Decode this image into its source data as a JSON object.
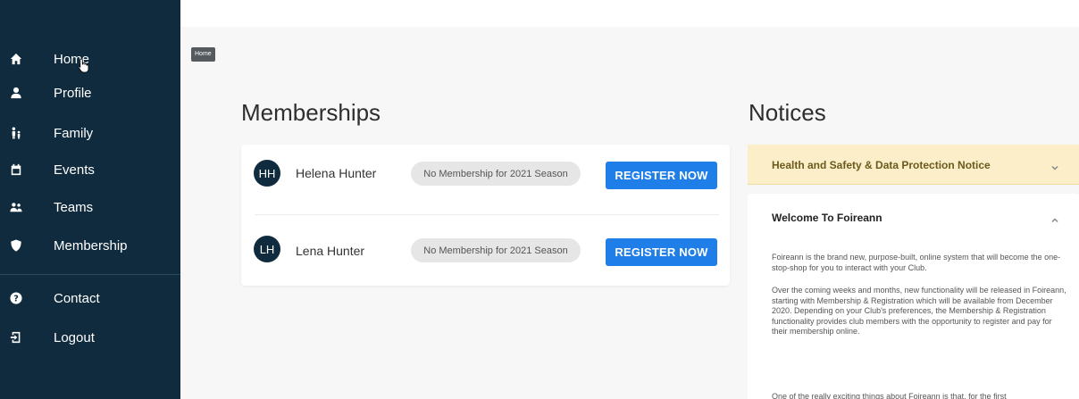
{
  "sidebar": {
    "items": [
      {
        "label": "Home",
        "icon": "home-icon"
      },
      {
        "label": "Profile",
        "icon": "user-icon"
      },
      {
        "label": "Family",
        "icon": "family-icon"
      },
      {
        "label": "Events",
        "icon": "calendar-icon"
      },
      {
        "label": "Teams",
        "icon": "team-icon"
      },
      {
        "label": "Membership",
        "icon": "shield-icon"
      },
      {
        "label": "Contact",
        "icon": "question-icon"
      },
      {
        "label": "Logout",
        "icon": "logout-icon"
      }
    ]
  },
  "breadcrumb": "Home",
  "memberships": {
    "title": "Memberships",
    "members": [
      {
        "initials": "HH",
        "name": "Helena Hunter",
        "status": "No Membership for 2021 Season",
        "action": "REGISTER NOW"
      },
      {
        "initials": "LH",
        "name": "Lena Hunter",
        "status": "No Membership for 2021 Season",
        "action": "REGISTER NOW"
      }
    ]
  },
  "notices": {
    "title": "Notices",
    "items": [
      {
        "title": "Health and Safety & Data Protection Notice",
        "expanded": false
      },
      {
        "title": "Welcome To Foireann",
        "expanded": true,
        "paragraphs": [
          "Foireann is the brand new, purpose-built, online system that will become the one-stop-shop for you to interact with your Club.",
          "Over the coming weeks and months, new functionality will be released in Foireann, starting with Membership & Registration which will be available from December 2020. Depending on your Club's preferences, the Membership & Registration functionality provides club members with the opportunity to register and pay for their membership online.",
          "One of the really exciting things about Foireann is that, for the first"
        ]
      }
    ]
  },
  "colors": {
    "sidebar": "#0f2b3d",
    "accent": "#1f7ee8",
    "notice_highlight": "#fbeec8"
  }
}
